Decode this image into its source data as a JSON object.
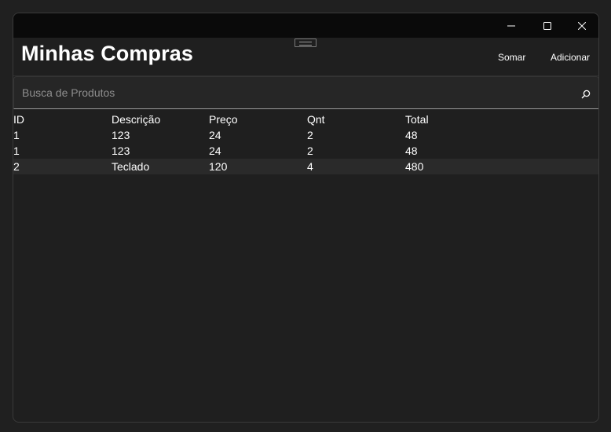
{
  "window": {
    "controls": {
      "minimize_icon": "minimize-icon",
      "maximize_icon": "maximize-icon",
      "close_icon": "close-icon"
    }
  },
  "header": {
    "title": "Minhas Compras",
    "buttons": {
      "somar": "Somar",
      "adicionar": "Adicionar"
    }
  },
  "search": {
    "placeholder": "Busca de Produtos",
    "value": "",
    "icon": "search-icon"
  },
  "table": {
    "columns": [
      "ID",
      "Descrição",
      "Preço",
      "Qnt",
      "Total"
    ],
    "rows": [
      [
        "1",
        "123",
        "24",
        "2",
        "48"
      ],
      [
        "1",
        "123",
        "24",
        "2",
        "48"
      ],
      [
        "2",
        "Teclado",
        "120",
        "4",
        "480"
      ]
    ],
    "highlighted_row": 2
  },
  "colors": {
    "background": "#202020",
    "titlebar": "#0a0a0a",
    "text": "#ffffff",
    "placeholder": "#8d8d8d"
  }
}
